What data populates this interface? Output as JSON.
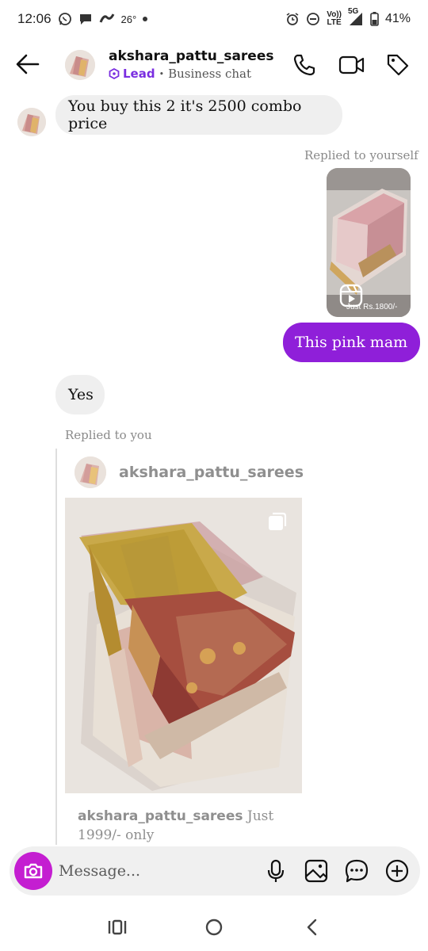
{
  "status_bar": {
    "time": "12:06",
    "temperature": "26°",
    "network_top": "Vo))",
    "network_bottom": "LTE",
    "signal_label": "5G",
    "battery": "41%"
  },
  "header": {
    "title": "akshara_pattu_sarees",
    "lead_label": "Lead",
    "separator": "•",
    "subtitle": "Business chat"
  },
  "messages": {
    "m1_text": "You buy this 2 it's 2500 combo price",
    "m2_meta": "Replied to yourself",
    "m2_reel_caption": "Just Rs.1800/-",
    "m3_text": "This pink mam",
    "m4_text": "Yes",
    "m5_meta": "Replied to you",
    "post_username": "akshara_pattu_sarees",
    "post_caption_user": "akshara_pattu_sarees",
    "post_caption_text": " Just 1999/- only"
  },
  "composer": {
    "placeholder": "Message..."
  },
  "colors": {
    "accent_purple": "#8f1fd9",
    "camera_magenta": "#c41ed1",
    "lead_purple": "#7a2ee0",
    "bubble_gray": "#efefef"
  },
  "icons": [
    "back-arrow-icon",
    "phone-icon",
    "video-icon",
    "tag-icon",
    "camera-icon",
    "microphone-icon",
    "gallery-icon",
    "chat-bubble-icon",
    "add-icon",
    "recents-icon",
    "home-icon",
    "nav-back-icon",
    "reel-icon",
    "carousel-icon"
  ]
}
